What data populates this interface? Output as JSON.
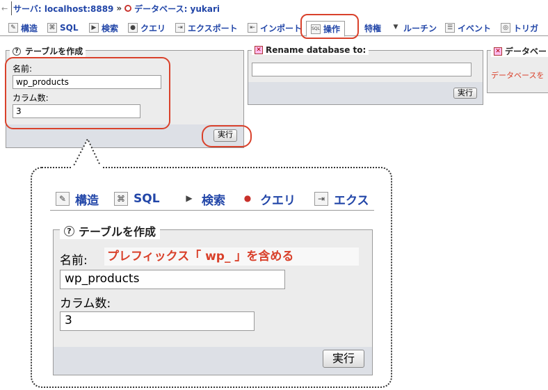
{
  "breadcrumb": {
    "back_arrow": "←",
    "server": "サーバ: localhost:8889",
    "separator": "»",
    "database": "データベース: yukari"
  },
  "tabs": [
    {
      "label": "構造",
      "icon": "structure-icon",
      "glyph": "✎"
    },
    {
      "label": "SQL",
      "icon": "sql-icon",
      "glyph": "⌘"
    },
    {
      "label": "検索",
      "icon": "search-icon",
      "glyph": "▶"
    },
    {
      "label": "クエリ",
      "icon": "query-icon",
      "glyph": "●"
    },
    {
      "label": "エクスポート",
      "icon": "export-icon",
      "glyph": "⇥"
    },
    {
      "label": "インポート",
      "icon": "import-icon",
      "glyph": "⇤"
    },
    {
      "label": "操作",
      "icon": "operations-icon",
      "glyph": "SQL"
    },
    {
      "label": "特権",
      "icon": "privileges-icon",
      "glyph": ""
    },
    {
      "label": "ルーチン",
      "icon": "routines-icon",
      "glyph": "▼"
    },
    {
      "label": "イベント",
      "icon": "events-icon",
      "glyph": "☰"
    },
    {
      "label": "トリガ",
      "icon": "triggers-icon",
      "glyph": "◎"
    }
  ],
  "create_table": {
    "legend": "テーブルを作成",
    "name_label": "名前:",
    "name_value": "wp_products",
    "columns_label": "カラム数:",
    "columns_value": "3",
    "go_button": "実行"
  },
  "rename_db": {
    "legend": "Rename database to:",
    "value": "",
    "go_button": "実行"
  },
  "copy_db": {
    "legend": "データベー",
    "notice": "データベースを"
  },
  "zoom": {
    "tabs": [
      "構造",
      "SQL",
      "検索",
      "クエリ",
      "エクス"
    ],
    "legend": "テーブルを作成",
    "name_label": "名前:",
    "annotation": "プレフィックス「 wp_ 」を含める",
    "name_value": "wp_products",
    "columns_label": "カラム数:",
    "columns_value": "3",
    "go_button": "実行"
  },
  "colors": {
    "link_blue": "#2246a8",
    "highlight_red": "#d9412b",
    "panel_bg": "#ececec",
    "footer_bg": "#dde0e6"
  }
}
